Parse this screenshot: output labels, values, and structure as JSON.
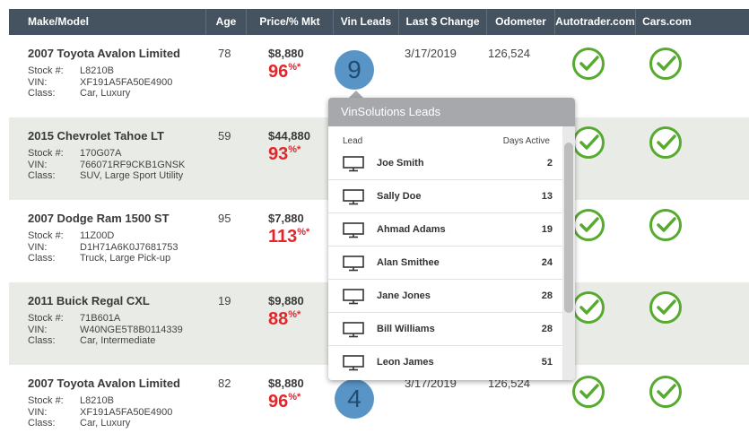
{
  "header": {
    "columns": [
      "Make/Model",
      "Age",
      "Price/% Mkt",
      "Vin Leads",
      "Last $ Change",
      "Odometer",
      "Autotrader.com",
      "Cars.com"
    ]
  },
  "labels": {
    "stock": "Stock #:",
    "vin": "VIN:",
    "class": "Class:"
  },
  "rows": [
    {
      "model": "2007 Toyota Avalon Limited",
      "stock": "L8210B",
      "vin": "XF191A5FA50E4900",
      "class": "Car, Luxury",
      "age": "78",
      "price": "$8,880",
      "pct": "96",
      "pct_suffix": "%*",
      "leads": "9",
      "date": "3/17/2019",
      "odometer": "126,524"
    },
    {
      "model": "2015 Chevrolet Tahoe LT",
      "stock": "170G07A",
      "vin": "766071RF9CKB1GNSK",
      "class": "SUV, Large Sport Utility",
      "age": "59",
      "price": "$44,880",
      "pct": "93",
      "pct_suffix": "%*"
    },
    {
      "model": "2007 Dodge Ram 1500 ST",
      "stock": "11Z00D",
      "vin": "D1H71A6K0J7681753",
      "class": "Truck, Large Pick-up",
      "age": "95",
      "price": "$7,880",
      "pct": "113",
      "pct_suffix": "%*"
    },
    {
      "model": "2011 Buick Regal CXL",
      "stock": "71B601A",
      "vin": "W40NGE5T8B0114339",
      "class": "Car, Intermediate",
      "age": "19",
      "price": "$9,880",
      "pct": "88",
      "pct_suffix": "%*"
    },
    {
      "model": "2007 Toyota Avalon Limited",
      "stock": "L8210B",
      "vin": "XF191A5FA50E4900",
      "class": "Car, Luxury",
      "age": "82",
      "price": "$8,880",
      "pct": "96",
      "pct_suffix": "%*",
      "leads": "4",
      "date": "3/17/2019",
      "odometer": "126,524"
    }
  ],
  "popup": {
    "title": "VinSolutions Leads",
    "col_lead": "Lead",
    "col_days": "Days Active",
    "leads": [
      {
        "name": "Joe Smith",
        "days": "2"
      },
      {
        "name": "Sally Doe",
        "days": "13"
      },
      {
        "name": "Ahmad Adams",
        "days": "19"
      },
      {
        "name": "Alan Smithee",
        "days": "24"
      },
      {
        "name": "Jane Jones",
        "days": "28"
      },
      {
        "name": "Bill Williams",
        "days": "28"
      },
      {
        "name": "Leon James",
        "days": "51"
      }
    ]
  },
  "colors": {
    "header": "#44535f",
    "check": "#56ab2f",
    "percent": "#e2262a",
    "bubble": "#5894c6",
    "popup_title": "#a6a8ab"
  },
  "icons": {
    "listed": "check-circle-icon",
    "lead": "monitor-icon"
  }
}
